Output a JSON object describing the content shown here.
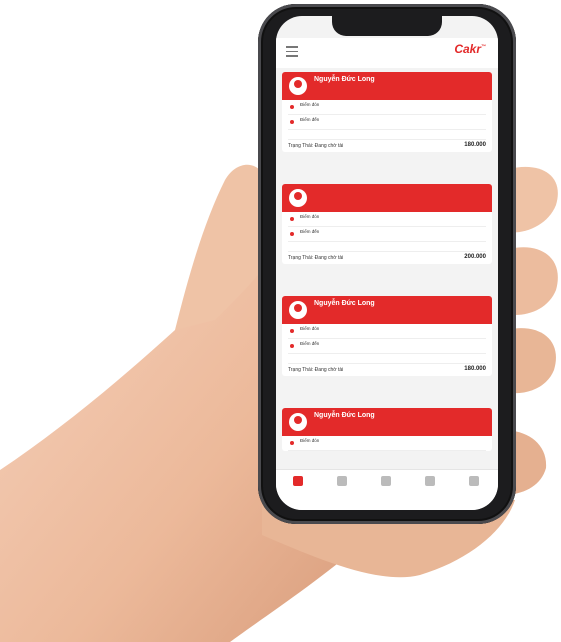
{
  "app": {
    "status_time": "",
    "logo_text": "Cakr",
    "logo_sup": "™"
  },
  "cards": [
    {
      "name": "Nguyễn Đức Long",
      "sub": "",
      "rows": [
        {
          "label": "Điểm đón",
          "text": ""
        },
        {
          "label": "Điểm đến",
          "text": ""
        }
      ],
      "meta_left": "",
      "meta_right": "",
      "total_label": "Trạng Thái: Đang chờ tài",
      "total_value": "180.000"
    },
    {
      "name": "",
      "sub": "",
      "rows": [
        {
          "label": "Điểm đón",
          "text": ""
        },
        {
          "label": "Điểm đến",
          "text": ""
        }
      ],
      "meta_left": "",
      "meta_right": "",
      "total_label": "Trạng Thái: Đang chờ tài",
      "total_value": "200.000"
    },
    {
      "name": "Nguyễn Đức Long",
      "sub": "",
      "rows": [
        {
          "label": "Điểm đón",
          "text": ""
        },
        {
          "label": "Điểm đến",
          "text": ""
        }
      ],
      "meta_left": "",
      "meta_right": "",
      "total_label": "Trạng Thái: Đang chờ tài",
      "total_value": "180.000"
    },
    {
      "name": "Nguyễn Đức Long",
      "sub": "",
      "rows": [
        {
          "label": "Điểm đón",
          "text": ""
        }
      ],
      "meta_left": "",
      "meta_right": "",
      "total_label": "",
      "total_value": ""
    }
  ],
  "tabs": [
    {
      "label": "",
      "active": true
    },
    {
      "label": "",
      "active": false
    },
    {
      "label": "",
      "active": false
    },
    {
      "label": "",
      "active": false
    },
    {
      "label": "",
      "active": false
    }
  ],
  "colors": {
    "accent": "#e32a2a",
    "skin": "#f0c2a6",
    "phone_body": "#1c1c1e"
  },
  "icons": [
    "menu-icon",
    "user-avatar-icon",
    "location-pin-icon"
  ]
}
